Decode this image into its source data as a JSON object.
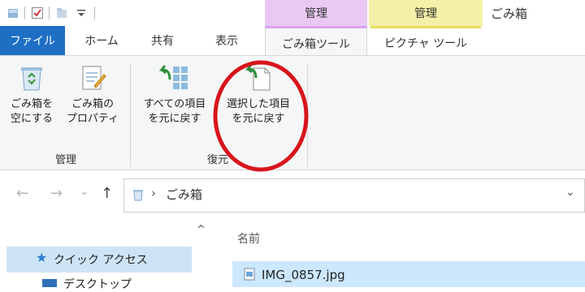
{
  "colors": {
    "file_tab": "#1e6fc4",
    "manage_purple": "#e9c9f4",
    "manage_yellow": "#f5f0a8",
    "ribbon_bg": "#f5f6f7",
    "selection": "#cce8ff",
    "highlight_circle": "#d8141b"
  },
  "context_headers": {
    "manage_1": "管理",
    "manage_2": "管理"
  },
  "window_title": "ごみ箱",
  "tabs": {
    "file": "ファイル",
    "home": "ホーム",
    "share": "共有",
    "view": "表示",
    "recycle_tools": "ごみ箱ツール",
    "picture_tools": "ピクチャ ツール"
  },
  "ribbon": {
    "manage_group": {
      "label": "管理",
      "empty_bin": {
        "line1": "ごみ箱を",
        "line2": "空にする",
        "icon": "recycle-bin-icon"
      },
      "properties": {
        "line1": "ごみ箱の",
        "line2": "プロパティ",
        "icon": "properties-icon"
      }
    },
    "restore_group": {
      "label": "復元",
      "restore_all": {
        "line1": "すべての項目",
        "line2": "を元に戻す",
        "icon": "restore-all-icon"
      },
      "restore_selected": {
        "line1": "選択した項目",
        "line2": "を元に戻す",
        "icon": "restore-selected-icon"
      }
    }
  },
  "address": {
    "back": "←",
    "forward": "→",
    "recent": "⌄",
    "up": "↑",
    "separator": "›",
    "location": "ごみ箱",
    "dropdown": "⌄"
  },
  "nav_pane": {
    "scroll_up": "^",
    "quick_access": "クイック アクセス",
    "desktop": "デスクトップ"
  },
  "content": {
    "column_name": "名前",
    "files": [
      "IMG_0857.jpg"
    ]
  }
}
